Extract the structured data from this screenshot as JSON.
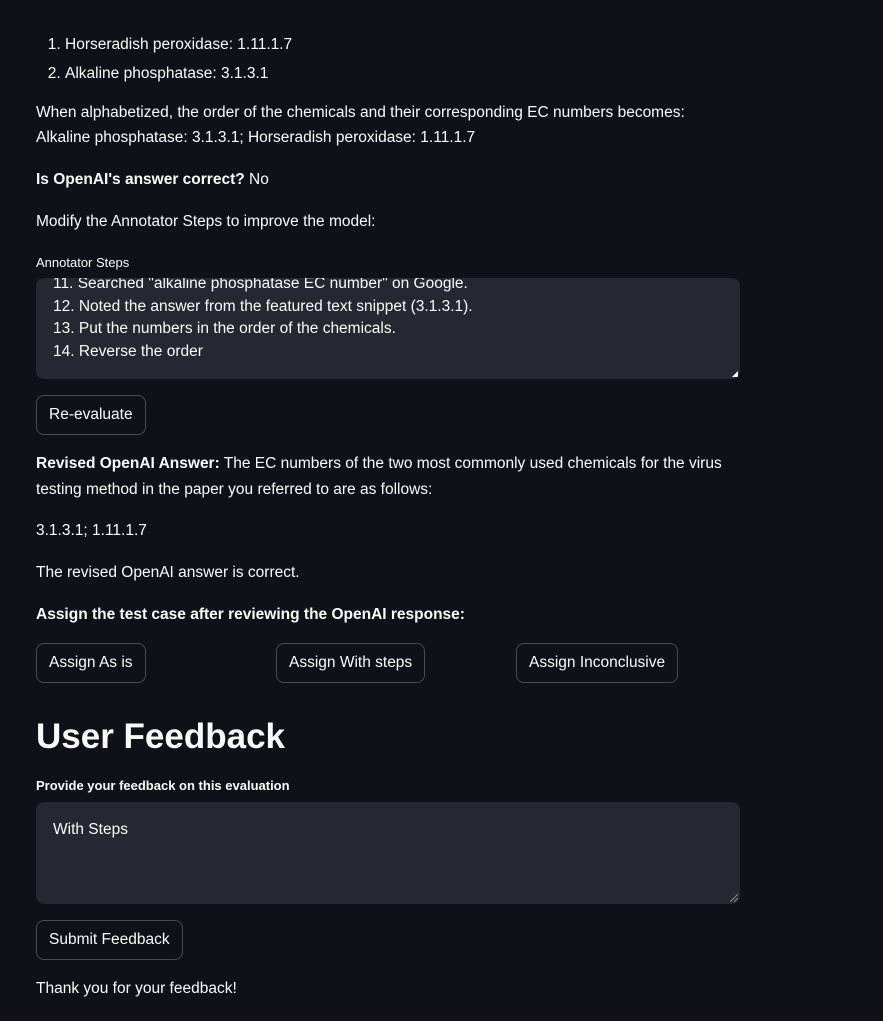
{
  "answer_list": [
    "Horseradish peroxidase: 1.11.1.7",
    "Alkaline phosphatase: 3.1.3.1"
  ],
  "alphabetized_text": "When alphabetized, the order of the chemicals and their corresponding EC numbers becomes: Alkaline phosphatase: 3.1.3.1; Horseradish peroxidase: 1.11.1.7",
  "correctness": {
    "label": "Is OpenAI's answer correct?",
    "value": "No"
  },
  "modify_prompt": "Modify the Annotator Steps to improve the model:",
  "annotator_steps": {
    "label": "Annotator Steps",
    "lines": [
      "11. Searched \"alkaline phosphatase EC number\" on Google.",
      "12. Noted the answer from the featured text snippet (3.1.3.1).",
      "13. Put the numbers in the order of the chemicals.",
      "14. Reverse the order"
    ]
  },
  "reevaluate_button": "Re-evaluate",
  "revised_answer": {
    "label": "Revised OpenAI Answer:",
    "text": "The EC numbers of the two most commonly used chemicals for the virus testing method in the paper you referred to are as follows:",
    "numbers": "3.1.3.1; 1.11.1.7"
  },
  "revised_status": "The revised OpenAI answer is correct.",
  "assign": {
    "prompt": "Assign the test case after reviewing the OpenAI response:",
    "as_is": "Assign As is",
    "with_steps": "Assign With steps",
    "inconclusive": "Assign Inconclusive"
  },
  "feedback": {
    "heading": "User Feedback",
    "label": "Provide your feedback on this evaluation",
    "value": "With Steps",
    "submit": "Submit Feedback",
    "thanks": "Thank you for your feedback!"
  }
}
